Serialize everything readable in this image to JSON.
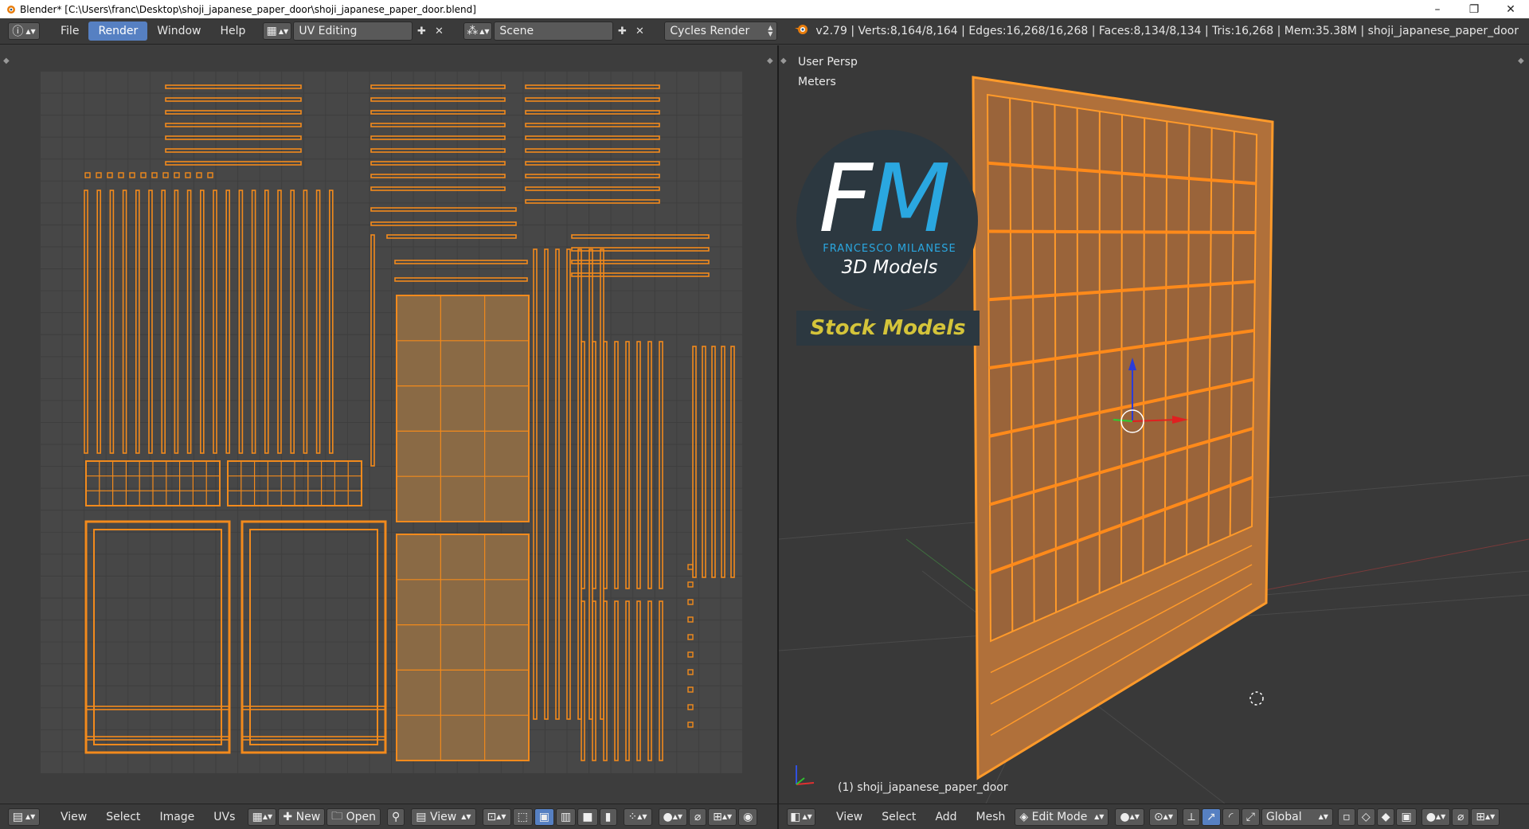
{
  "window": {
    "title": "Blender* [C:\\Users\\franc\\Desktop\\shoji_japanese_paper_door\\shoji_japanese_paper_door.blend]",
    "controls": [
      "–",
      "❐",
      "✕"
    ]
  },
  "info_header": {
    "menus": [
      "File",
      "Render",
      "Window",
      "Help"
    ],
    "active_menu": "Render",
    "screen_layout": "UV Editing",
    "scene": "Scene",
    "render_engine": "Cycles Render",
    "stats": "v2.79 | Verts:8,164/8,164 | Edges:16,268/16,268 | Faces:8,134/8,134 | Tris:16,268 | Mem:35.38M | shoji_japanese_paper_door"
  },
  "uv_editor": {
    "header": {
      "menus": [
        "View",
        "Select",
        "Image",
        "UVs"
      ],
      "new_label": "New",
      "open_label": "Open",
      "view_label": "View"
    }
  },
  "viewport": {
    "perspective": "User Persp",
    "units": "Meters",
    "object_label": "(1) shoji_japanese_paper_door",
    "header": {
      "menus": [
        "View",
        "Select",
        "Add",
        "Mesh"
      ],
      "mode": "Edit Mode",
      "orientation": "Global"
    }
  },
  "watermark": {
    "initials_f": "F",
    "initials_m": "M",
    "name": "FRANCESCO MILANESE",
    "subtitle": "3D Models",
    "banner": "Stock Models"
  },
  "colors": {
    "accent": "#5680c2",
    "uv_orange": "#f28a1c",
    "face_fill": "#8a6a45",
    "logo_blue": "#2aa7e0",
    "banner_yellow": "#d4c43a"
  }
}
